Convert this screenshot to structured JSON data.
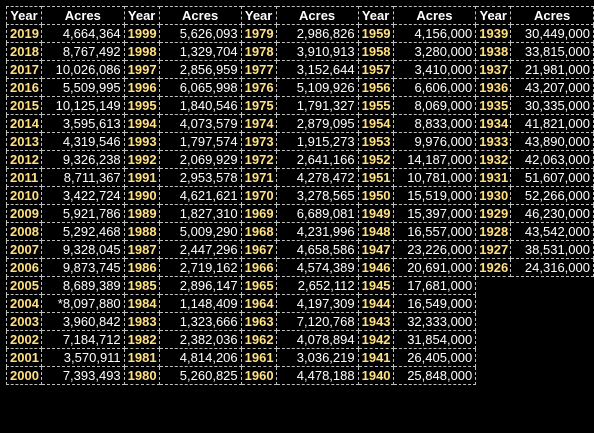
{
  "header": {
    "year": "Year",
    "acres": "Acres"
  },
  "rows": [
    [
      [
        "2019",
        "4,664,364"
      ],
      [
        "1999",
        "5,626,093"
      ],
      [
        "1979",
        "2,986,826"
      ],
      [
        "1959",
        "4,156,000"
      ],
      [
        "1939",
        "30,449,000"
      ]
    ],
    [
      [
        "2018",
        "8,767,492"
      ],
      [
        "1998",
        "1,329,704"
      ],
      [
        "1978",
        "3,910,913"
      ],
      [
        "1958",
        "3,280,000"
      ],
      [
        "1938",
        "33,815,000"
      ]
    ],
    [
      [
        "2017",
        "10,026,086"
      ],
      [
        "1997",
        "2,856,959"
      ],
      [
        "1977",
        "3,152,644"
      ],
      [
        "1957",
        "3,410,000"
      ],
      [
        "1937",
        "21,981,000"
      ]
    ],
    [
      [
        "2016",
        "5,509,995"
      ],
      [
        "1996",
        "6,065,998"
      ],
      [
        "1976",
        "5,109,926"
      ],
      [
        "1956",
        "6,606,000"
      ],
      [
        "1936",
        "43,207,000"
      ]
    ],
    [
      [
        "2015",
        "10,125,149"
      ],
      [
        "1995",
        "1,840,546"
      ],
      [
        "1975",
        "1,791,327"
      ],
      [
        "1955",
        "8,069,000"
      ],
      [
        "1935",
        "30,335,000"
      ]
    ],
    [
      [
        "2014",
        "3,595,613"
      ],
      [
        "1994",
        "4,073,579"
      ],
      [
        "1974",
        "2,879,095"
      ],
      [
        "1954",
        "8,833,000"
      ],
      [
        "1934",
        "41,821,000"
      ]
    ],
    [
      [
        "2013",
        "4,319,546"
      ],
      [
        "1993",
        "1,797,574"
      ],
      [
        "1973",
        "1,915,273"
      ],
      [
        "1953",
        "9,976,000"
      ],
      [
        "1933",
        "43,890,000"
      ]
    ],
    [
      [
        "2012",
        "9,326,238"
      ],
      [
        "1992",
        "2,069,929"
      ],
      [
        "1972",
        "2,641,166"
      ],
      [
        "1952",
        "14,187,000"
      ],
      [
        "1932",
        "42,063,000"
      ]
    ],
    [
      [
        "2011",
        "8,711,367"
      ],
      [
        "1991",
        "2,953,578"
      ],
      [
        "1971",
        "4,278,472"
      ],
      [
        "1951",
        "10,781,000"
      ],
      [
        "1931",
        "51,607,000"
      ]
    ],
    [
      [
        "2010",
        "3,422,724"
      ],
      [
        "1990",
        "4,621,621"
      ],
      [
        "1970",
        "3,278,565"
      ],
      [
        "1950",
        "15,519,000"
      ],
      [
        "1930",
        "52,266,000"
      ]
    ],
    [
      [
        "2009",
        "5,921,786"
      ],
      [
        "1989",
        "1,827,310"
      ],
      [
        "1969",
        "6,689,081"
      ],
      [
        "1949",
        "15,397,000"
      ],
      [
        "1929",
        "46,230,000"
      ]
    ],
    [
      [
        "2008",
        "5,292,468"
      ],
      [
        "1988",
        "5,009,290"
      ],
      [
        "1968",
        "4,231,996"
      ],
      [
        "1948",
        "16,557,000"
      ],
      [
        "1928",
        "43,542,000"
      ]
    ],
    [
      [
        "2007",
        "9,328,045"
      ],
      [
        "1987",
        "2,447,296"
      ],
      [
        "1967",
        "4,658,586"
      ],
      [
        "1947",
        "23,226,000"
      ],
      [
        "1927",
        "38,531,000"
      ]
    ],
    [
      [
        "2006",
        "9,873,745"
      ],
      [
        "1986",
        "2,719,162"
      ],
      [
        "1966",
        "4,574,389"
      ],
      [
        "1946",
        "20,691,000"
      ],
      [
        "1926",
        "24,316,000"
      ]
    ],
    [
      [
        "2005",
        "8,689,389"
      ],
      [
        "1985",
        "2,896,147"
      ],
      [
        "1965",
        "2,652,112"
      ],
      [
        "1945",
        "17,681,000"
      ]
    ],
    [
      [
        "2004",
        "*8,097,880"
      ],
      [
        "1984",
        "1,148,409"
      ],
      [
        "1964",
        "4,197,309"
      ],
      [
        "1944",
        "16,549,000"
      ]
    ],
    [
      [
        "2003",
        "3,960,842"
      ],
      [
        "1983",
        "1,323,666"
      ],
      [
        "1963",
        "7,120,768"
      ],
      [
        "1943",
        "32,333,000"
      ]
    ],
    [
      [
        "2002",
        "7,184,712"
      ],
      [
        "1982",
        "2,382,036"
      ],
      [
        "1962",
        "4,078,894"
      ],
      [
        "1942",
        "31,854,000"
      ]
    ],
    [
      [
        "2001",
        "3,570,911"
      ],
      [
        "1981",
        "4,814,206"
      ],
      [
        "1961",
        "3,036,219"
      ],
      [
        "1941",
        "26,405,000"
      ]
    ],
    [
      [
        "2000",
        "7,393,493"
      ],
      [
        "1980",
        "5,260,825"
      ],
      [
        "1960",
        "4,478,188"
      ],
      [
        "1940",
        "25,848,000"
      ]
    ]
  ]
}
